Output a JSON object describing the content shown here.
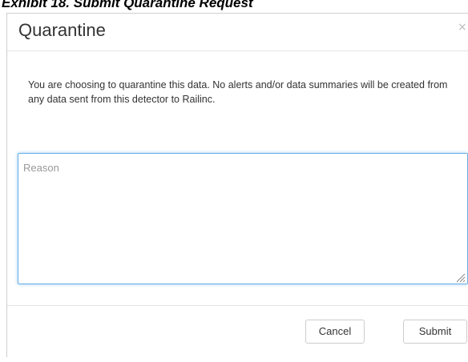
{
  "caption": "Exhibit 18. Submit Quarantine Request",
  "dialog": {
    "title": "Quarantine",
    "close_glyph": "×",
    "message": "You are choosing to quarantine this data. No alerts and/or data summaries will be created from any data sent from this detector to Railinc.",
    "reason_placeholder": "Reason",
    "reason_value": "",
    "cancel_label": "Cancel",
    "submit_label": "Submit"
  },
  "icons": {
    "close": "close-icon",
    "resize": "resize-grip-icon"
  },
  "colors": {
    "focus_border": "#66afe9",
    "text": "#333333",
    "close": "#bbbbbb"
  }
}
